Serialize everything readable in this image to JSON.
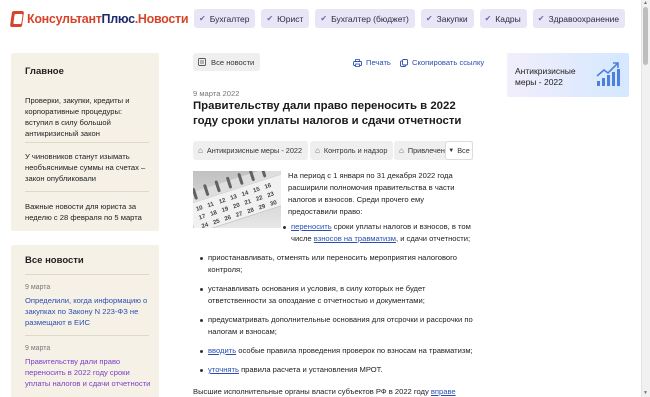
{
  "header": {
    "logo_part1": "Консультант",
    "logo_part2": "Плюс",
    "logo_part3": ".Новости",
    "nav": [
      {
        "label": "Бухгалтер"
      },
      {
        "label": "Юрист"
      },
      {
        "label": "Бухгалтер (бюджет)"
      },
      {
        "label": "Закупки"
      },
      {
        "label": "Кадры"
      },
      {
        "label": "Здравоохранение"
      }
    ]
  },
  "sidebar": {
    "main": {
      "title": "Главное",
      "items": [
        "Проверки, закупки, кредиты и корпоративные процедуры: вступил в силу большой антикризисный закон",
        "У чиновников станут изымать необъяснимые суммы на счетах – закон опубликовали",
        "Важные новости для юриста за неделю с 28 февраля по 5 марта"
      ]
    },
    "all": {
      "title": "Все новости",
      "items": [
        {
          "date": "9 марта",
          "text": "Определили, когда информацию о закупках по Закону N 223-ФЗ не размещают в ЕИС"
        },
        {
          "date": "9 марта",
          "text": "Правительству дали право переносить в 2022 году сроки уплаты налогов и сдачи отчетности"
        }
      ]
    }
  },
  "article": {
    "all_news_label": "Все новости",
    "print_label": "Печать",
    "copy_label": "Скопировать ссылку",
    "date": "9 марта 2022",
    "title": "Правительству дали право переносить в 2022 году сроки уплаты налогов и сдачи отчетности",
    "tags": [
      "Антикризисные меры - 2022",
      "Контроль и надзор",
      "Привлечение к ответственности"
    ],
    "more_label": "Все",
    "intro": "На период с 1 января по 31 декабря 2022 года расширили полномочия правительства в части налогов и взносов. Среди прочего ему предоставили право:",
    "bullets": {
      "b1_link": "переносить",
      "b1_text1": " сроки уплаты налогов и взносов, в том числе ",
      "b1_link2": "взносов на травматизм",
      "b1_text2": ", и сдачи отчетности;",
      "b2": "приостанавливать, отменять или переносить мероприятия налогового контроля;",
      "b3": "устанавливать основания и условия, в силу которых не будет ответственности за опоздание с отчетностью и документами;",
      "b4": "предусматривать дополнительные основания для отсрочки и рассрочки по налогам и взносам;",
      "b5_link": "вводить",
      "b5_text": " особые правила проведения проверок по взносам на травматизм;",
      "b6_link": "уточнять",
      "b6_text": " правила расчета и установления МРОТ."
    },
    "outro_text": "Высшие исполнительные органы власти субъектов РФ в 2022 году ",
    "outro_link": "вправе"
  },
  "promo": {
    "text": "Антикризисные меры - 2022"
  },
  "colors": {
    "accent": "#2a4fb0",
    "brand_red": "#d6442b",
    "brand_blue": "#1d2a6b",
    "nav_bg": "#e8e6f6",
    "sidebar_bg": "#f6f1e7"
  }
}
